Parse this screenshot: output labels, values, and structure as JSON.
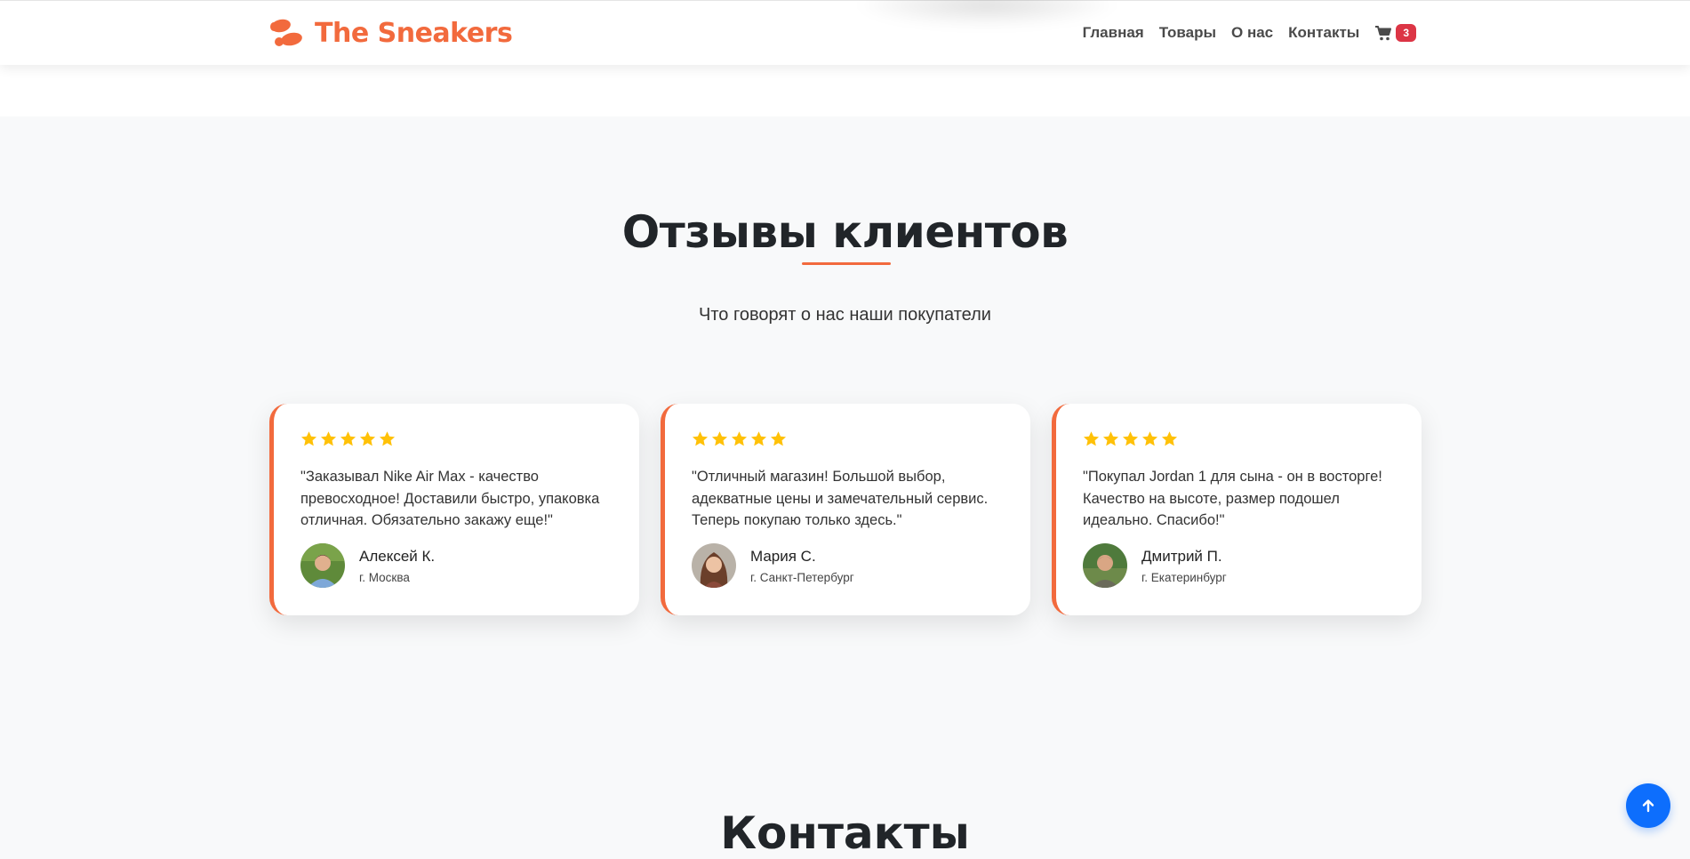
{
  "brand": {
    "name": "The Sneakers",
    "color": "#f26a3d"
  },
  "nav": {
    "links": [
      "Главная",
      "Товары",
      "О нас",
      "Контакты"
    ],
    "cart_icon": "cart-icon",
    "cart_count": "3"
  },
  "reviews_section": {
    "title": "Отзывы клиентов",
    "subtitle": "Что говорят о нас наши покупатели",
    "accent_color": "#f26a3d",
    "reviews": [
      {
        "rating": 5,
        "text": "\"Заказывал Nike Air Max - качество превосходное! Доставили быстро, упаковка отличная. Обязательно закажу еще!\"",
        "name": "Алексей К.",
        "city": "г. Москва"
      },
      {
        "rating": 5,
        "text": "\"Отличный магазин! Большой выбор, адекватные цены и замечательный сервис. Теперь покупаю только здесь.\"",
        "name": "Мария С.",
        "city": "г. Санкт-Петербург"
      },
      {
        "rating": 5,
        "text": "\"Покупал Jordan 1 для сына - он в восторге! Качество на высоте, размер подошел идеально. Спасибо!\"",
        "name": "Дмитрий П.",
        "city": "г. Екатеринбург"
      }
    ]
  },
  "contacts_section": {
    "title": "Контакты"
  },
  "scroll_top": {
    "icon": "arrow-up-icon",
    "color": "#0d6efd"
  }
}
